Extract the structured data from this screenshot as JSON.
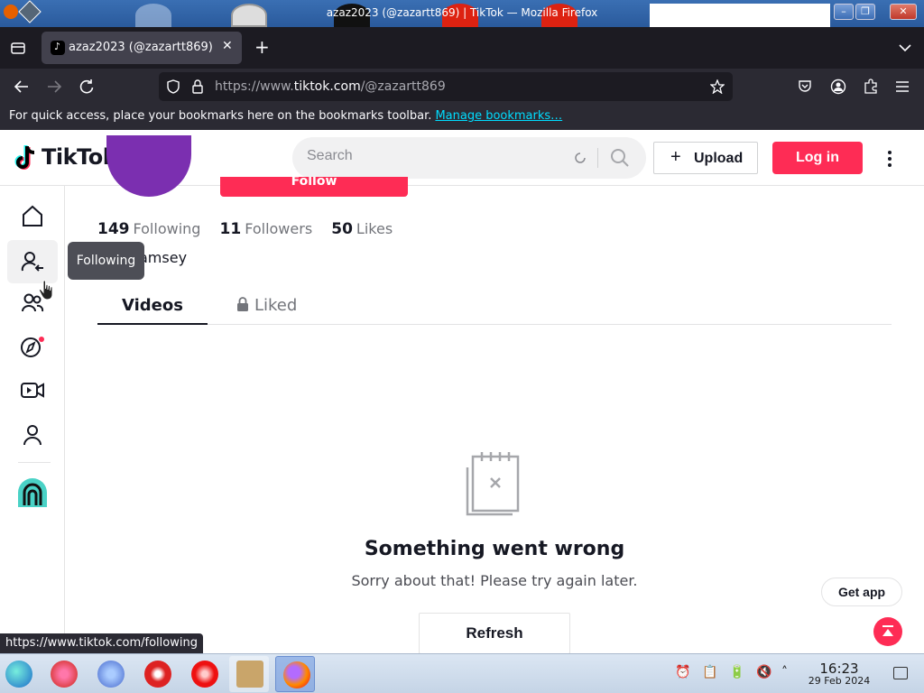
{
  "window": {
    "title": "azaz2023 (@zazartt869) | TikTok — Mozilla Firefox",
    "minimize": "–",
    "maximize": "❐",
    "close": "✕"
  },
  "browser": {
    "tab_title": "azaz2023 (@zazartt869) | TikTok",
    "new_tab": "+",
    "url_prefix": "https://www.",
    "url_domain": "tiktok.com",
    "url_path": "/@zazartt869",
    "bookmarks_message": "For quick access, place your bookmarks here on the bookmarks toolbar.",
    "bookmarks_link": "Manage bookmarks…",
    "status_url": "https://www.tiktok.com/following"
  },
  "header": {
    "logo_text": "TikTok",
    "search_placeholder": "Search",
    "upload_label": "Upload",
    "login_label": "Log in"
  },
  "profile": {
    "follow_label": "Follow",
    "stats": [
      {
        "value": "149",
        "label": "Following"
      },
      {
        "value": "11",
        "label": "Followers"
      },
      {
        "value": "50",
        "label": "Likes"
      }
    ],
    "bio_fragment": "amsey",
    "tooltip": "Following",
    "tabs": {
      "videos": "Videos",
      "liked": "Liked"
    }
  },
  "error": {
    "title": "Something went wrong",
    "subtitle": "Sorry about that! Please try again later.",
    "refresh_label": "Refresh"
  },
  "floating": {
    "get_app_label": "Get app"
  },
  "taskbar": {
    "time": "16:23",
    "date": "29 Feb 2024"
  },
  "colors": {
    "brand": "#fe2c55",
    "text": "#161823",
    "firefox_dark": "#2b2a33"
  }
}
